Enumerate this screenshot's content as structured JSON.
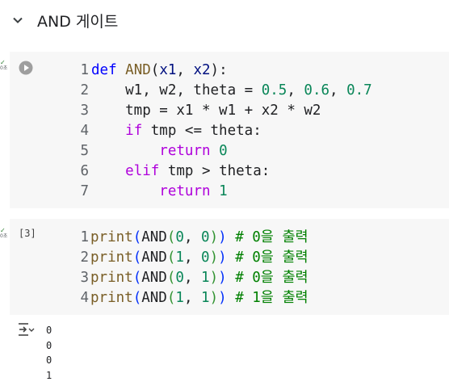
{
  "section": {
    "title": "AND 게이트",
    "icon": "chevron-down-icon"
  },
  "cells": [
    {
      "gutter": {
        "mark": "✓",
        "time": "0초"
      },
      "run_icon": "play-circle-icon",
      "exec_count": "",
      "lines": [
        {
          "n": "1",
          "tokens": [
            [
              "kw",
              "def"
            ],
            [
              "tx",
              " "
            ],
            [
              "fn",
              "AND"
            ],
            [
              "tx",
              "("
            ],
            [
              "var",
              "x1"
            ],
            [
              "tx",
              ", "
            ],
            [
              "var",
              "x2"
            ],
            [
              "tx",
              "):"
            ]
          ]
        },
        {
          "n": "2",
          "tokens": [
            [
              "tx",
              "    w1, w2, theta = "
            ],
            [
              "num",
              "0.5"
            ],
            [
              "tx",
              ", "
            ],
            [
              "num",
              "0.6"
            ],
            [
              "tx",
              ", "
            ],
            [
              "num",
              "0.7"
            ]
          ]
        },
        {
          "n": "3",
          "tokens": [
            [
              "tx",
              "    tmp = x1 * w1 + x2 * w2"
            ]
          ]
        },
        {
          "n": "4",
          "tokens": [
            [
              "tx",
              "    "
            ],
            [
              "kw2",
              "if"
            ],
            [
              "tx",
              " tmp <= theta:"
            ]
          ]
        },
        {
          "n": "5",
          "tokens": [
            [
              "tx",
              "        "
            ],
            [
              "kw2",
              "return"
            ],
            [
              "tx",
              " "
            ],
            [
              "num",
              "0"
            ]
          ]
        },
        {
          "n": "6",
          "tokens": [
            [
              "tx",
              "    "
            ],
            [
              "kw2",
              "elif"
            ],
            [
              "tx",
              " tmp > theta:"
            ]
          ]
        },
        {
          "n": "7",
          "tokens": [
            [
              "tx",
              "        "
            ],
            [
              "kw2",
              "return"
            ],
            [
              "tx",
              " "
            ],
            [
              "num",
              "1"
            ]
          ]
        }
      ]
    },
    {
      "gutter": {
        "mark": "✓",
        "time": "0초"
      },
      "exec_count": "[3]",
      "lines": [
        {
          "n": "1",
          "tokens": [
            [
              "fn",
              "print"
            ],
            [
              "p1",
              "("
            ],
            [
              "tx",
              "AND"
            ],
            [
              "p2",
              "("
            ],
            [
              "num",
              "0"
            ],
            [
              "tx",
              ", "
            ],
            [
              "num",
              "0"
            ],
            [
              "p2",
              ")"
            ],
            [
              "p1",
              ")"
            ],
            [
              "tx",
              " "
            ],
            [
              "cm",
              "# 0을 출력"
            ]
          ]
        },
        {
          "n": "2",
          "tokens": [
            [
              "fn",
              "print"
            ],
            [
              "p1",
              "("
            ],
            [
              "tx",
              "AND"
            ],
            [
              "p2",
              "("
            ],
            [
              "num",
              "1"
            ],
            [
              "tx",
              ", "
            ],
            [
              "num",
              "0"
            ],
            [
              "p2",
              ")"
            ],
            [
              "p1",
              ")"
            ],
            [
              "tx",
              " "
            ],
            [
              "cm",
              "# 0을 출력"
            ]
          ]
        },
        {
          "n": "3",
          "tokens": [
            [
              "fn",
              "print"
            ],
            [
              "p1",
              "("
            ],
            [
              "tx",
              "AND"
            ],
            [
              "p2",
              "("
            ],
            [
              "num",
              "0"
            ],
            [
              "tx",
              ", "
            ],
            [
              "num",
              "1"
            ],
            [
              "p2",
              ")"
            ],
            [
              "p1",
              ")"
            ],
            [
              "tx",
              " "
            ],
            [
              "cm",
              "# 0을 출력"
            ]
          ]
        },
        {
          "n": "4",
          "tokens": [
            [
              "fn",
              "print"
            ],
            [
              "p1",
              "("
            ],
            [
              "tx",
              "AND"
            ],
            [
              "p2",
              "("
            ],
            [
              "num",
              "1"
            ],
            [
              "tx",
              ", "
            ],
            [
              "num",
              "1"
            ],
            [
              "p2",
              ")"
            ],
            [
              "p1",
              ")"
            ],
            [
              "tx",
              " "
            ],
            [
              "cm",
              "# 1을 출력"
            ]
          ]
        }
      ],
      "output_icon": "output-actions-icon",
      "output": [
        "0",
        "0",
        "0",
        "1"
      ]
    }
  ],
  "colors": {
    "keyword": "#0000ff",
    "control": "#af00db",
    "function": "#795e26",
    "number": "#098658",
    "variable": "#001080",
    "comment": "#008000",
    "cell_bg": "#f7f7f7",
    "check": "#2e7d32"
  }
}
